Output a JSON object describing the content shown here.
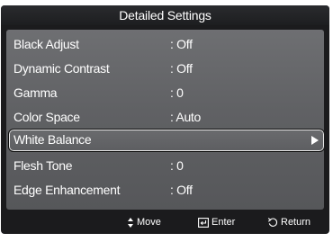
{
  "menu": {
    "title": "Detailed Settings",
    "items": [
      {
        "label": "Black Adjust",
        "value": ": Off"
      },
      {
        "label": "Dynamic Contrast",
        "value": ": Off"
      },
      {
        "label": "Gamma",
        "value": ": 0"
      },
      {
        "label": "Color Space",
        "value": ": Auto"
      },
      {
        "label": "White Balance",
        "value": ""
      },
      {
        "label": "Flesh Tone",
        "value": ": 0"
      },
      {
        "label": "Edge Enhancement",
        "value": ": Off"
      }
    ],
    "selected_index": 4,
    "selected_indicator_icon": "right-triangle-icon"
  },
  "footer": {
    "move_label": "Move",
    "move_icon": "up-down-arrows-icon",
    "enter_label": "Enter",
    "enter_icon": "enter-icon",
    "return_label": "Return",
    "return_icon": "return-arrow-icon"
  },
  "colors": {
    "panel_background": "#1b1b1d",
    "list_background": "#606164",
    "text": "#ffffff"
  }
}
